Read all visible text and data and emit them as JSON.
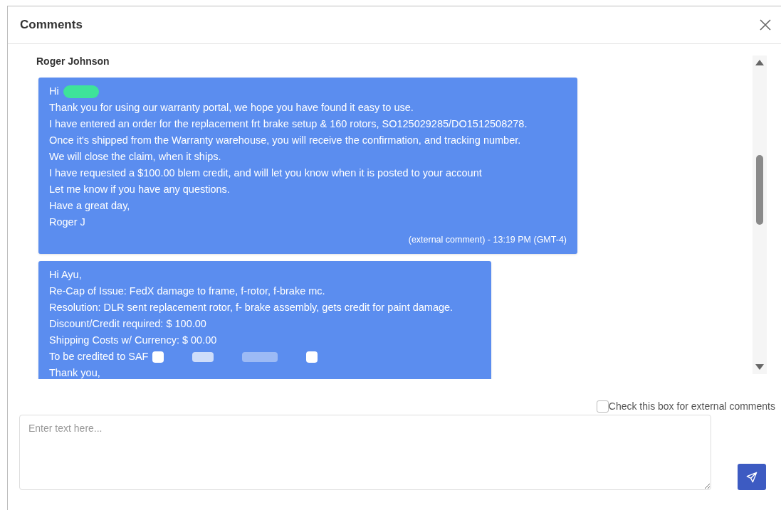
{
  "dialog": {
    "title": "Comments"
  },
  "thread": {
    "author": "Roger Johnson",
    "messages": [
      {
        "lines": [
          {
            "text": "Hi",
            "color": "#3ee39a"
          },
          {
            "text": "Thank you for using our warranty portal, we hope you have found it easy to use."
          },
          {
            "text": "I have entered an order for the replacement frt brake setup & 160 rotors, SO125029285/DO1512508278."
          },
          {
            "text": "Once it's shipped from the Warranty warehouse, you will receive the confirmation, and tracking number."
          },
          {
            "text": "We will close the claim, when it ships."
          },
          {
            "text": "I have requested a $100.00 blem credit, and will let you know when it is posted to your account"
          },
          {
            "text": "Let me know if you have any questions."
          },
          {
            "text": "Have a great day,"
          },
          {
            "text": "Roger J"
          }
        ],
        "footer": "(external comment) - 13:19 PM (GMT-4)"
      },
      {
        "lines": [
          {
            "text": "Hi Ayu,"
          },
          {
            "text": "Re-Cap of Issue: FedX damage to frame, f-rotor, f-brake mc."
          },
          {
            "text": "Resolution: DLR sent replacement rotor, f- brake assembly, gets credit for paint damage."
          },
          {
            "text": "Discount/Credit required: $ 100.00"
          },
          {
            "text": "Shipping Costs w/ Currency: $ 00.00"
          },
          {
            "text": "To be credited to SAF",
            "color": "#ffffff"
          },
          {
            "text": "Thank you,"
          }
        ]
      }
    ]
  },
  "external_checkbox": {
    "label": "Check this box for external comments",
    "checked": false
  },
  "comment_field": {
    "placeholder": "Enter text here..."
  }
}
